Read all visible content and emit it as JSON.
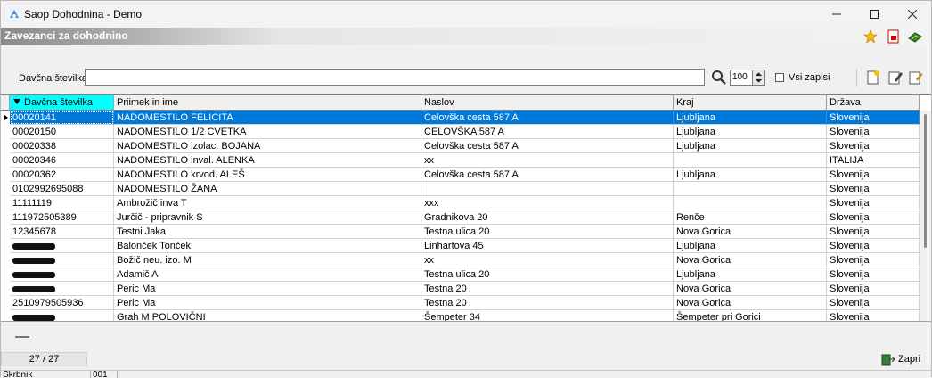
{
  "window": {
    "title": "Saop Dohodnina - Demo"
  },
  "module": {
    "title": "Zavezanci za dohodnino"
  },
  "search": {
    "label": "Davčna številka",
    "value": "",
    "limit": "100",
    "show_all_label": "Vsi zapisi",
    "show_all_checked": false
  },
  "grid": {
    "columns": [
      "Davčna številka",
      "Priimek in ime",
      "Naslov",
      "Kraj",
      "Država"
    ],
    "sorted_column": "Davčna številka",
    "selected_row": 0,
    "rows": [
      {
        "tax": "00020141",
        "name": "NADOMESTILO  FELICITA",
        "addr": "Celovška cesta 587 A",
        "city": "Ljubljana",
        "country": "Slovenija"
      },
      {
        "tax": "00020150",
        "name": "NADOMESTILO 1/2  CVETKA",
        "addr": "CELOVŠKA 587 A",
        "city": "Ljubljana",
        "country": "Slovenija"
      },
      {
        "tax": "00020338",
        "name": "NADOMESTILO izolac. BOJANA",
        "addr": "Celovška cesta 587 A",
        "city": "Ljubljana",
        "country": "Slovenija"
      },
      {
        "tax": "00020346",
        "name": "NADOMESTILO inval. ALENKA",
        "addr": "xx",
        "city": "",
        "country": "ITALIJA"
      },
      {
        "tax": "00020362",
        "name": "NADOMESTILO krvod. ALEŠ",
        "addr": "Celovška cesta 587 A",
        "city": "Ljubljana",
        "country": "Slovenija"
      },
      {
        "tax": "0102992695088",
        "name": "NADOMESTILO ŽANA",
        "addr": "",
        "city": "",
        "country": "Slovenija"
      },
      {
        "tax": "11111119",
        "name": "Ambrožič inva T",
        "addr": "xxx",
        "city": "",
        "country": "Slovenija"
      },
      {
        "tax": "111972505389",
        "name": "Jurčič - pripravnik S",
        "addr": "Gradnikova 20",
        "city": "Renče",
        "country": "Slovenija"
      },
      {
        "tax": "12345678",
        "name": "Testni Jaka",
        "addr": "Testna ulica 20",
        "city": "Nova Gorica",
        "country": "Slovenija"
      },
      {
        "tax": "",
        "name": "Balonček  Tonček",
        "addr": "Linhartova 45",
        "city": "Ljubljana",
        "country": "Slovenija"
      },
      {
        "tax": "",
        "name": "Božič neu. izo. M",
        "addr": "xx",
        "city": "Nova Gorica",
        "country": "Slovenija"
      },
      {
        "tax": "",
        "name": "Adamič A",
        "addr": "Testna ulica 20",
        "city": "Ljubljana",
        "country": "Slovenija"
      },
      {
        "tax": "",
        "name": "Peric Ma",
        "addr": "Testna 20",
        "city": "Nova Gorica",
        "country": "Slovenija"
      },
      {
        "tax": "2510979505936",
        "name": "Peric Ma",
        "addr": "Testna 20",
        "city": "Nova Gorica",
        "country": "Slovenija"
      },
      {
        "tax": "",
        "name": "Grah M POLOVIČNI",
        "addr": "Šempeter 34",
        "city": "Šempeter pri Gorici",
        "country": "Slovenija"
      }
    ]
  },
  "footer": {
    "counter": "27 / 27",
    "close_label": "Zapri",
    "status": [
      "Skrbnik",
      "001"
    ]
  },
  "colors": {
    "selection": "#0078d7",
    "sorted_header": "#00ffff"
  }
}
